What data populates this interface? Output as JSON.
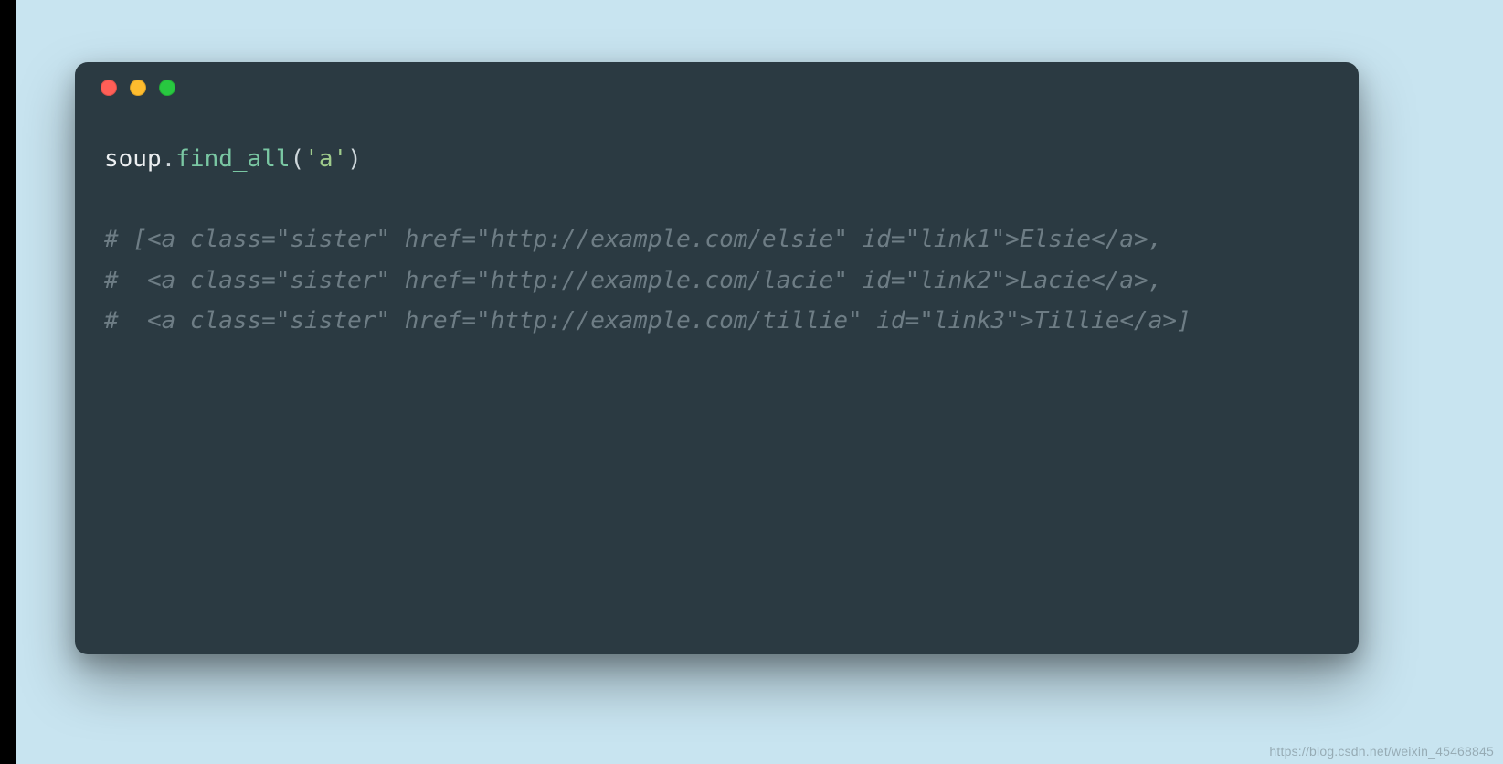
{
  "window": {
    "traffic_lights": [
      "close",
      "minimize",
      "zoom"
    ]
  },
  "code": {
    "line1": {
      "obj": "soup",
      "dot": ".",
      "func": "find_all",
      "lparen": "(",
      "arg": "'a'",
      "rparen": ")"
    },
    "blank": "",
    "comment1": "# [<a class=\"sister\" href=\"http://example.com/elsie\" id=\"link1\">Elsie</a>,",
    "comment2": "#  <a class=\"sister\" href=\"http://example.com/lacie\" id=\"link2\">Lacie</a>,",
    "comment3": "#  <a class=\"sister\" href=\"http://example.com/tillie\" id=\"link3\">Tillie</a>]"
  },
  "watermark": "https://blog.csdn.net/weixin_45468845"
}
